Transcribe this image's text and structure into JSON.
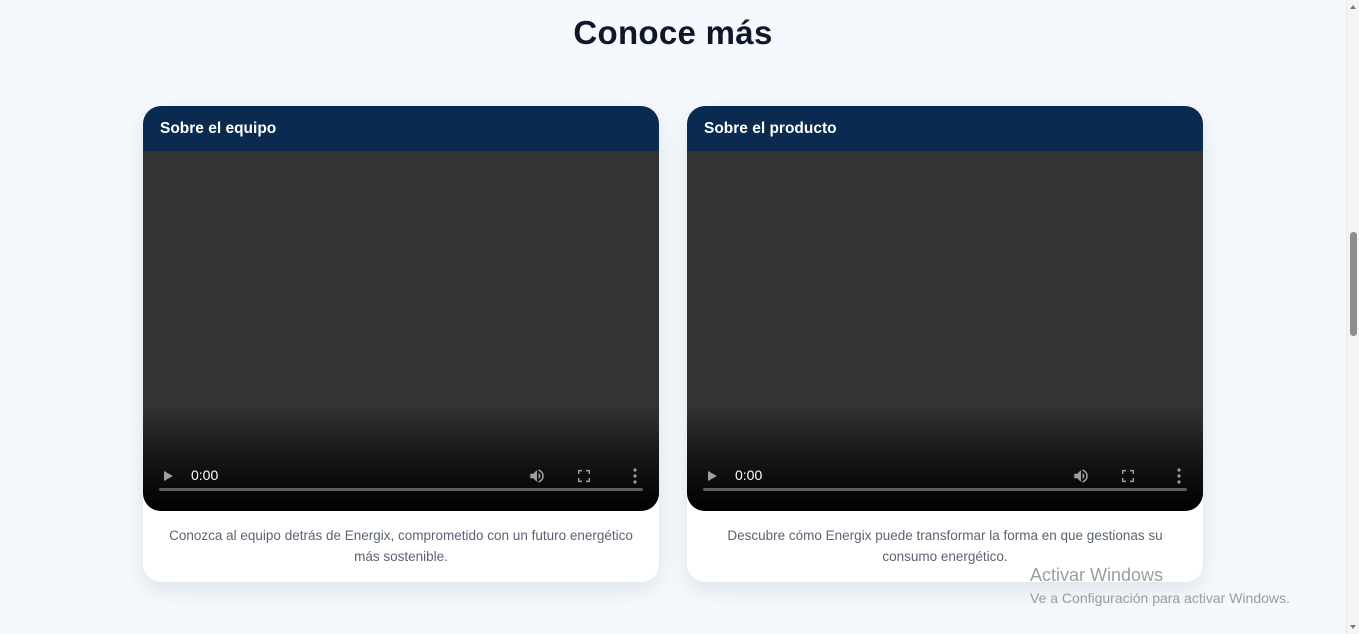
{
  "section": {
    "title": "Conoce más"
  },
  "cards": [
    {
      "header": "Sobre el equipo",
      "video": {
        "time": "0:00"
      },
      "description": "Conozca al equipo detrás de Energix, comprometido con un futuro energético más sostenible."
    },
    {
      "header": "Sobre el producto",
      "video": {
        "time": "0:00"
      },
      "description": "Descubre cómo Energix puede transformar la forma en que gestionas su consumo energético."
    }
  ],
  "watermark": {
    "title": "Activar Windows",
    "subtitle": "Ve a Configuración para activar Windows."
  },
  "icons": {
    "play": "play-icon",
    "volume": "volume-icon",
    "fullscreen": "fullscreen-icon",
    "more": "more-vert-icon"
  },
  "colors": {
    "page_bg": "#f5f9fd",
    "card_header_bg": "#0a2a4f",
    "video_bg": "#333333",
    "title_text": "#0f172a",
    "desc_text": "#5b6474"
  }
}
